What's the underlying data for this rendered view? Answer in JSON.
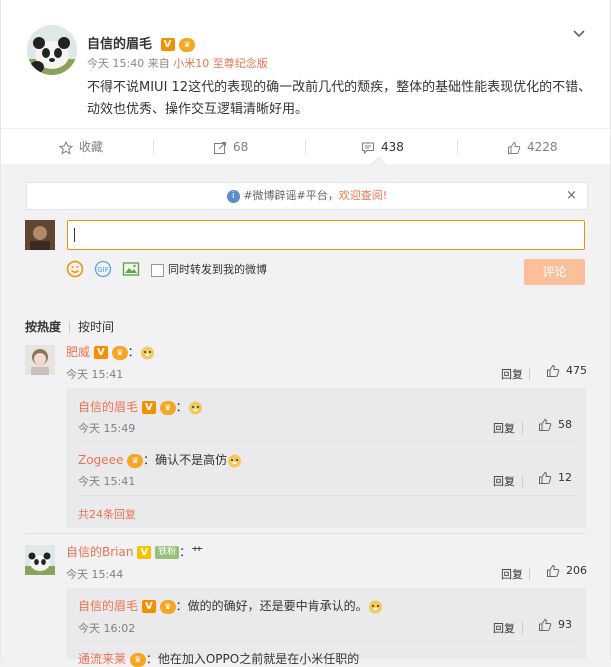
{
  "post": {
    "author": "自信的眉毛",
    "vip_badge": "V",
    "time": "今天 15:40",
    "from_label": "来自",
    "source": "小米10 至尊纪念版",
    "text": "不得不说MIUI 12这代的表现的确一改前几代的颓疾，整体的基础性能表现优化的不错、动效也优秀、操作交互逻辑清晰好用。"
  },
  "actions": {
    "favorite": "收藏",
    "repost_count": "68",
    "comment_count": "438",
    "like_count": "4228"
  },
  "notice": {
    "prefix": "#微博辟谣#平台，",
    "link": "欢迎查阅!",
    "close": "×"
  },
  "composer": {
    "repost_label": "同时转发到我的微博",
    "submit": "评论"
  },
  "sort": {
    "hot": "按热度",
    "time": "按时间"
  },
  "comments": [
    {
      "name": "肥威",
      "badge": "V",
      "text": "：",
      "time": "今天 15:41",
      "reply": "回复",
      "likes": "475"
    },
    {
      "name": "自信的Brian",
      "badge": "铁粉",
      "text": "：艹",
      "time": "今天 15:44",
      "reply": "回复",
      "likes": "206"
    }
  ],
  "replies": [
    {
      "name": "自信的眉毛",
      "badge": "V",
      "text": "：",
      "time": "今天 15:49",
      "reply": "回复",
      "likes": "58"
    },
    {
      "name": "Zogeee",
      "text": "：确认不是高仿",
      "time": "今天 15:41",
      "reply": "回复",
      "likes": "12"
    },
    {
      "name": "自信的眉毛",
      "badge": "V",
      "text": "：做的的确好，还是要中肯承认的。",
      "time": "今天 16:02",
      "reply": "回复",
      "likes": "93"
    },
    {
      "name": "通流来莱",
      "text": "：他在加入OPPO之前就是在小米任职的"
    }
  ],
  "more_replies": "共24条回复",
  "colors": {
    "accent": "#eb7350",
    "vbadge": "#f29100"
  }
}
